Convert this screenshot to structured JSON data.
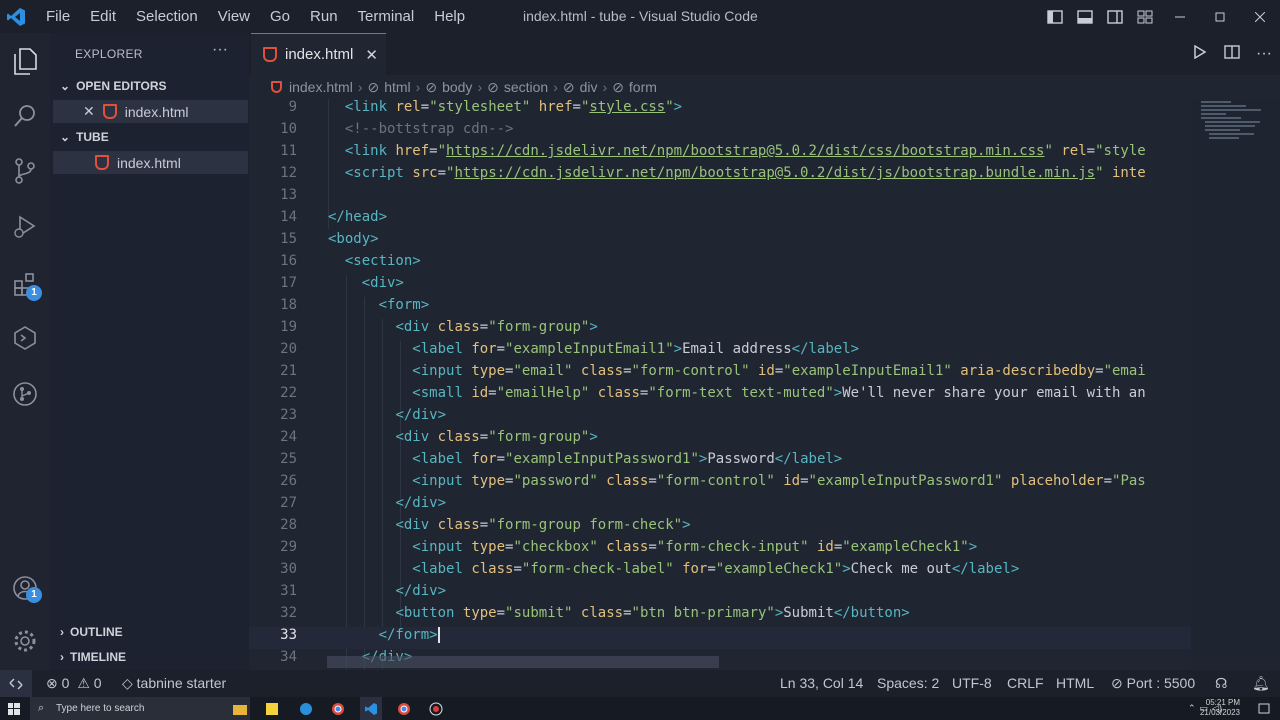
{
  "titlebar": {
    "menu": [
      "File",
      "Edit",
      "Selection",
      "View",
      "Go",
      "Run",
      "Terminal",
      "Help"
    ],
    "title": "index.html - tube - Visual Studio Code"
  },
  "activity": {
    "extensions_badge": "1",
    "accounts_badge": "1"
  },
  "sidebar": {
    "header": "EXPLORER",
    "dots": "···",
    "open_editors": "OPEN EDITORS",
    "open_file": "index.html",
    "folder": "TUBE",
    "folder_file": "index.html",
    "outline": "OUTLINE",
    "timeline": "TIMELINE"
  },
  "editor": {
    "tab_label": "index.html",
    "tab_close": "✕",
    "breadcrumb": [
      "index.html",
      "html",
      "body",
      "section",
      "div",
      "form"
    ]
  },
  "status": {
    "errors": "0",
    "warnings": "0",
    "tabnine": "tabnine starter",
    "position": "Ln 33, Col 14",
    "spaces": "Spaces: 2",
    "encoding": "UTF-8",
    "eol": "CRLF",
    "language": "HTML",
    "port": "Port : 5500"
  },
  "taskbar": {
    "search_placeholder": "Type here to search",
    "time": "05:21 PM",
    "date": "21/03/2023"
  },
  "code": {
    "cursor_line": 33
  }
}
